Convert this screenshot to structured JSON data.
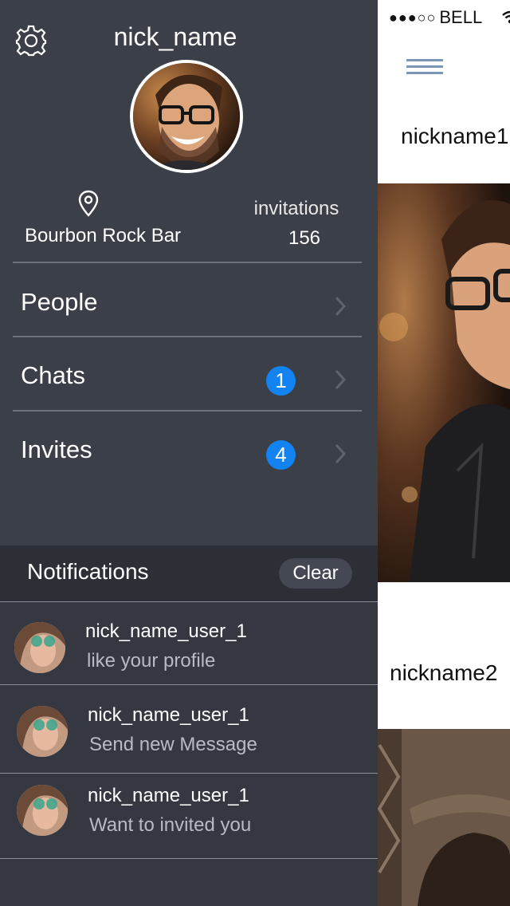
{
  "status_bar": {
    "signal_dots": "●●●○○",
    "carrier": "BELL"
  },
  "feed": {
    "items": [
      {
        "nickname": "nickname1"
      },
      {
        "nickname": "nickname2"
      }
    ]
  },
  "profile": {
    "nick_name": "nick_name",
    "location": "Bourbon Rock Bar",
    "invitations_label": "invitations",
    "invitations_count": "156"
  },
  "menu": {
    "items": [
      {
        "label": "People",
        "badge": ""
      },
      {
        "label": "Chats",
        "badge": "1"
      },
      {
        "label": "Invites",
        "badge": "4"
      }
    ]
  },
  "notifications": {
    "title": "Notifications",
    "clear_label": "Clear",
    "items": [
      {
        "user": "nick_name_user_1",
        "text": "like your profile"
      },
      {
        "user": "nick_name_user_1",
        "text": "Send new Message"
      },
      {
        "user": "nick_name_user_1",
        "text": "Want to invited you"
      }
    ]
  },
  "colors": {
    "drawer_bg": "#3b3f48",
    "notification_header_bg": "#2c2f36",
    "badge_blue": "#1283f0",
    "menu_icon_blue": "#7a96b8"
  },
  "icons": [
    "settings-gear-icon",
    "location-pin-icon",
    "chevron-right-icon",
    "hamburger-menu-icon",
    "wifi-icon"
  ]
}
